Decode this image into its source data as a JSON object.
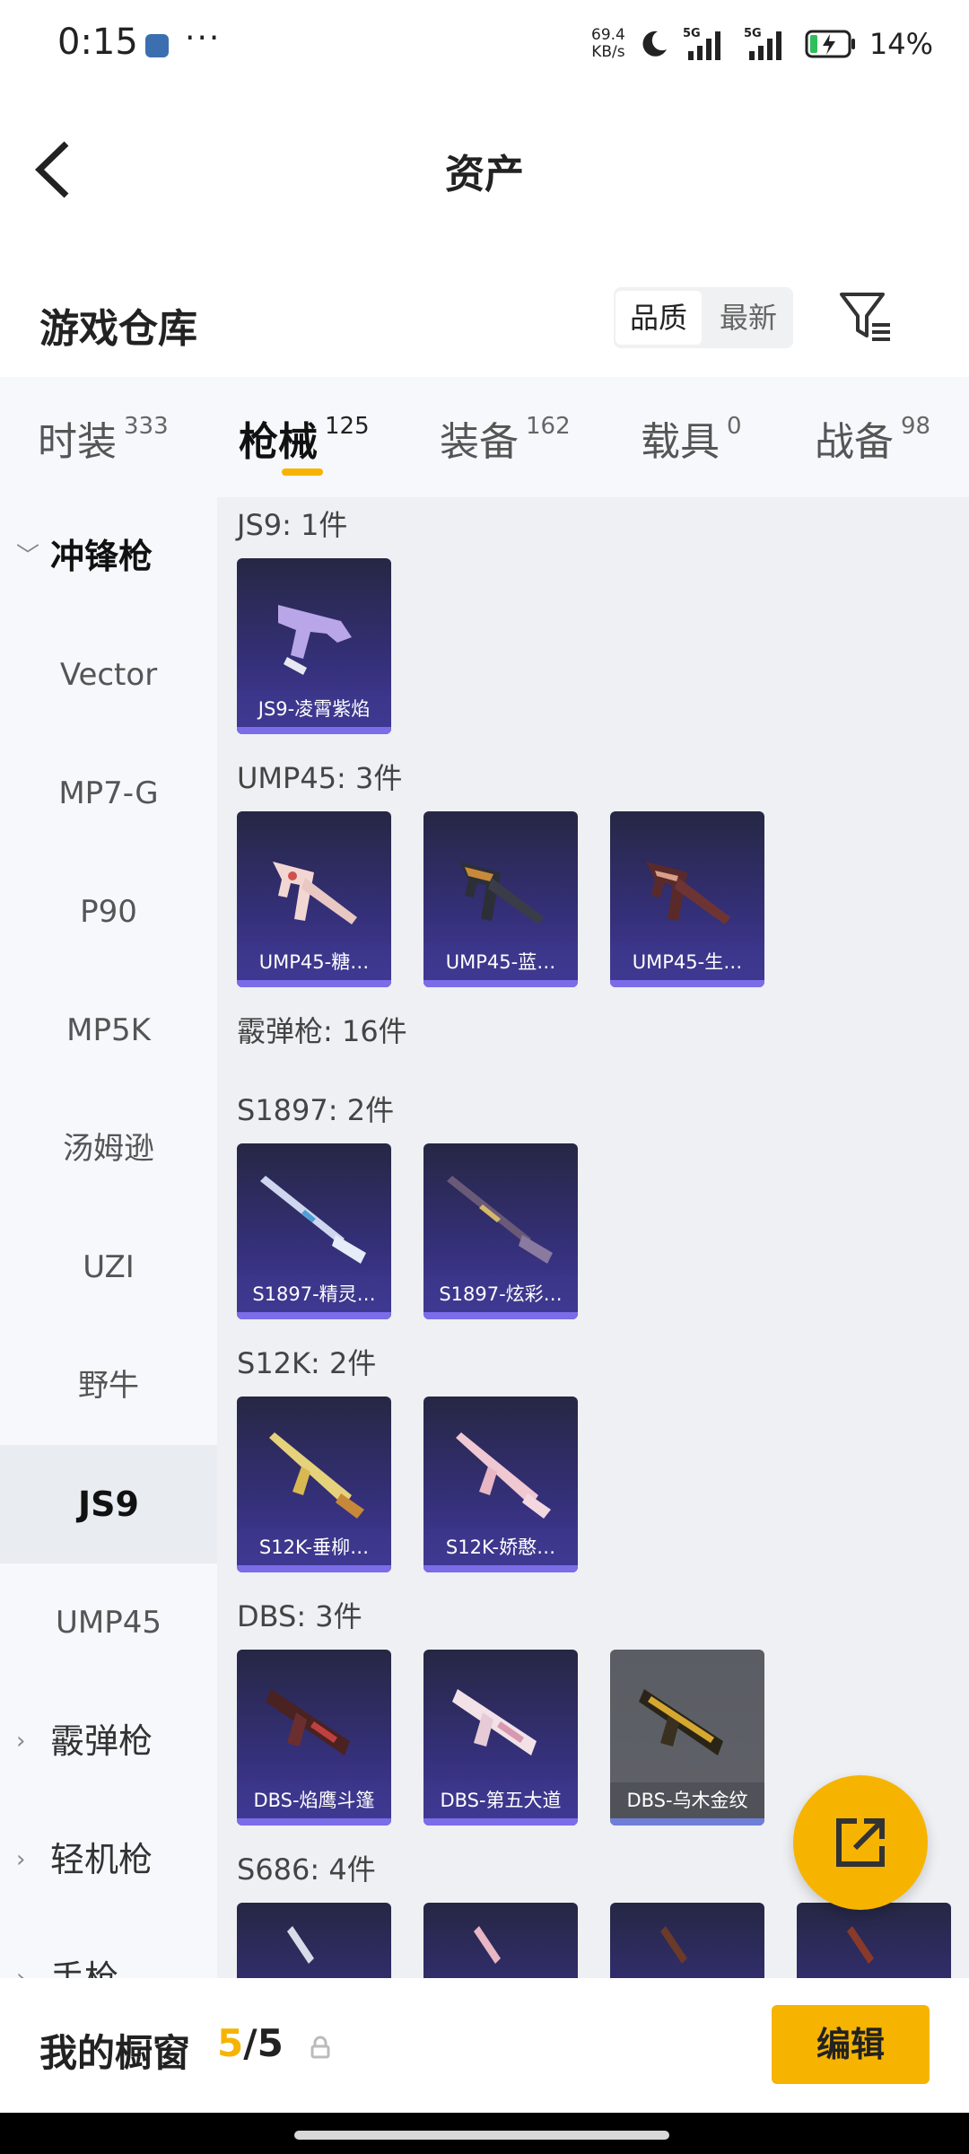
{
  "status_bar": {
    "time": "0:15",
    "net_speed_value": "69.4",
    "net_speed_unit": "KB/s",
    "signal_1": "5G",
    "signal_2": "5G",
    "battery": "14%"
  },
  "header": {
    "title": "资产"
  },
  "section": {
    "title": "游戏仓库",
    "sort_options": [
      "品质",
      "最新"
    ],
    "sort_selected": "品质"
  },
  "tabs": [
    {
      "label": "时装",
      "count": "333"
    },
    {
      "label": "枪械",
      "count": "125",
      "active": true
    },
    {
      "label": "装备",
      "count": "162"
    },
    {
      "label": "载具",
      "count": "0"
    },
    {
      "label": "战备",
      "count": "98"
    }
  ],
  "sidebar": {
    "group_open": "冲锋枪",
    "items": [
      "Vector",
      "MP7-G",
      "P90",
      "MP5K",
      "汤姆逊",
      "UZI",
      "野牛",
      "JS9",
      "UMP45"
    ],
    "selected": "JS9",
    "groups_collapsed": [
      "霰弹枪",
      "轻机枪",
      "手枪"
    ]
  },
  "content": {
    "groups": [
      {
        "title": "JS9: 1件",
        "items": [
          "JS9-凌霄紫焰"
        ]
      },
      {
        "title": "UMP45: 3件",
        "items": [
          "UMP45-糖…",
          "UMP45-蓝…",
          "UMP45-生…"
        ]
      },
      {
        "title": "霰弹枪: 16件",
        "items": []
      },
      {
        "title": "S1897: 2件",
        "items": [
          "S1897-精灵…",
          "S1897-炫彩…"
        ]
      },
      {
        "title": "S12K: 2件",
        "items": [
          "S12K-垂柳…",
          "S12K-娇憨…"
        ]
      },
      {
        "title": "DBS: 3件",
        "items": [
          "DBS-焰鹰斗篷",
          "DBS-第五大道",
          "DBS-乌木金纹"
        ]
      },
      {
        "title": "S686: 4件",
        "items": []
      }
    ]
  },
  "bottom_bar": {
    "label": "我的橱窗",
    "current": "5",
    "total": "/5",
    "edit_label": "编辑"
  },
  "colors": {
    "accent": "#f6b400",
    "card_purple": "#35307a",
    "card_gray": "#5f6268"
  }
}
